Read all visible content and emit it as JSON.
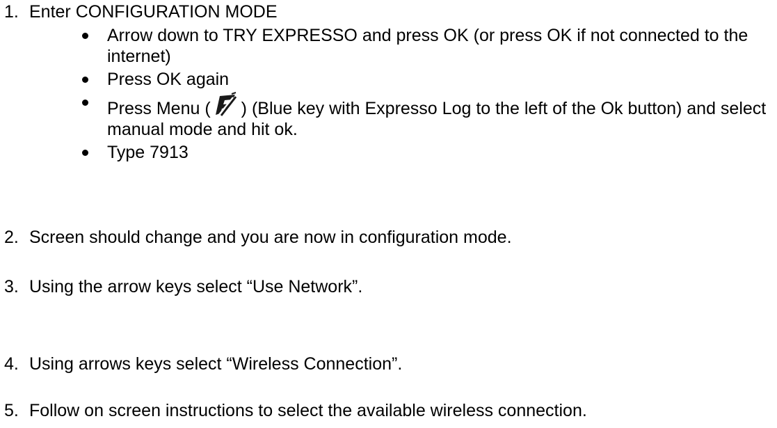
{
  "steps": [
    {
      "number": "1.",
      "text": "Enter CONFIGURATION MODE",
      "bullets": [
        {
          "text": "Arrow down to TRY EXPRESSO and press OK (or press OK if not connected to the internet)"
        },
        {
          "text": "Press OK again"
        },
        {
          "before": "Press Menu (",
          "after": ") (Blue key with Expresso Log to the left of the Ok button) and select manual mode and hit ok."
        },
        {
          "text": "Type 7913"
        }
      ]
    },
    {
      "number": "2.",
      "text": "Screen should change and you are now in configuration mode."
    },
    {
      "number": "3.",
      "text": "Using the arrow keys select “Use Network”."
    },
    {
      "number": "4.",
      "text": "Using arrows keys select “Wireless Connection”."
    },
    {
      "number": "5.",
      "text": "Follow on screen instructions to select the available wireless connection."
    }
  ]
}
